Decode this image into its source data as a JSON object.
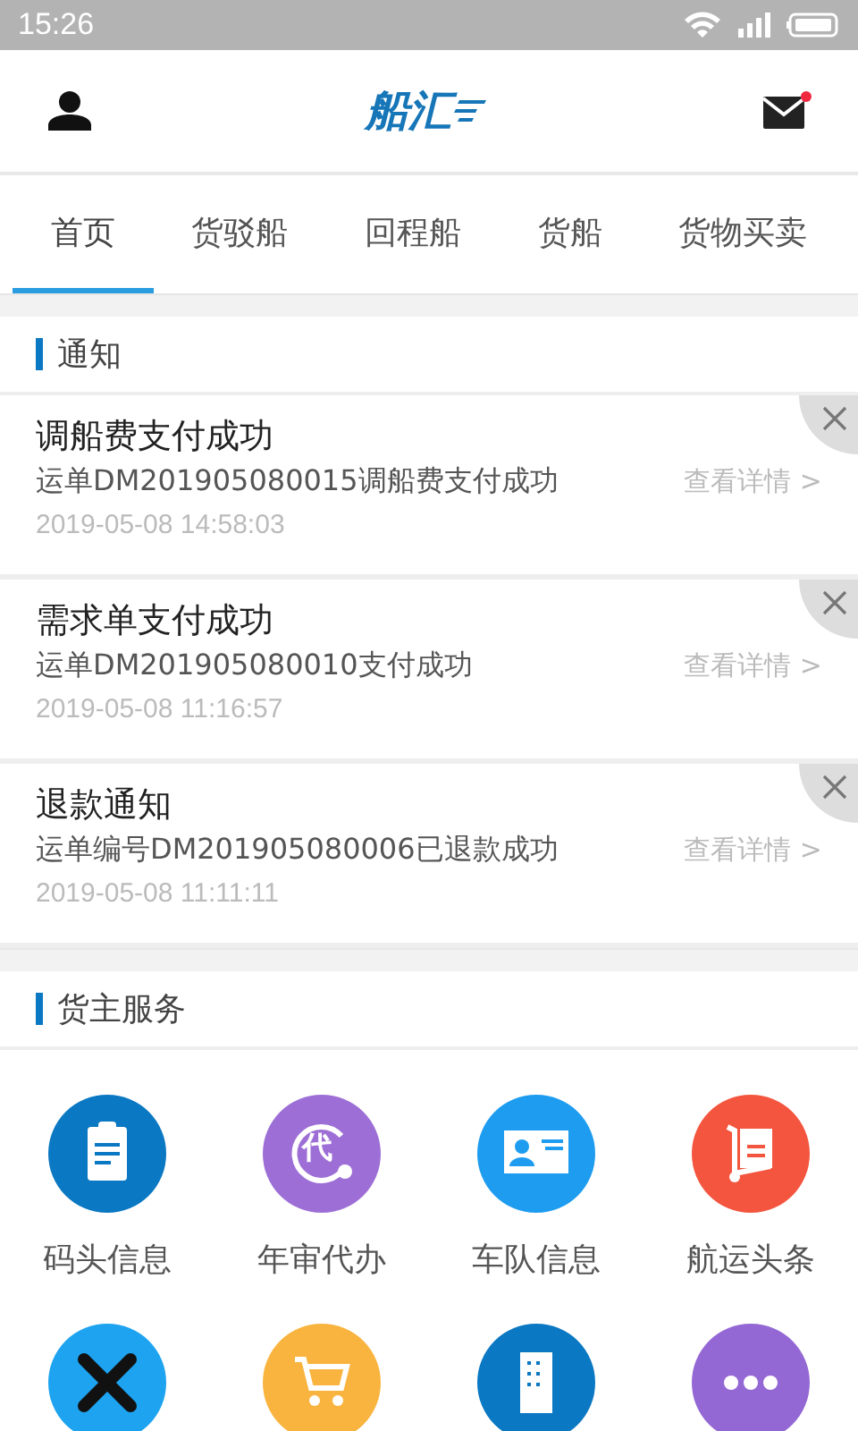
{
  "status_bar": {
    "time": "15:26"
  },
  "header": {
    "logo": "船汇",
    "mail_unread": true
  },
  "tabs": [
    {
      "label": "首页",
      "selected": true
    },
    {
      "label": "货驳船",
      "selected": false
    },
    {
      "label": "回程船",
      "selected": false
    },
    {
      "label": "货船",
      "selected": false
    },
    {
      "label": "货物买卖",
      "selected": false
    }
  ],
  "notices": {
    "title": "通知",
    "items": [
      {
        "title": "调船费支付成功",
        "body": "运单DM201905080015调船费支付成功",
        "time": "2019-05-08 14:58:03",
        "link": "查看详情 >"
      },
      {
        "title": "需求单支付成功",
        "body": "运单DM201905080010支付成功",
        "time": "2019-05-08 11:16:57",
        "link": "查看详情 >"
      },
      {
        "title": "退款通知",
        "body": "运单编号DM201905080006已退款成功",
        "time": "2019-05-08 11:11:11",
        "link": "查看详情 >"
      }
    ]
  },
  "services": {
    "title": "货主服务",
    "items": [
      {
        "kind": "clipboard",
        "label": "码头信息",
        "color": "#0a78c2"
      },
      {
        "kind": "agent",
        "label": "年审代办",
        "badge_text": "代",
        "color": "#9d6fd6"
      },
      {
        "kind": "idcard",
        "label": "车队信息",
        "color": "#1e9cf0"
      },
      {
        "kind": "cart",
        "label": "航运头条",
        "color": "#f4553e"
      },
      {
        "kind": "tools",
        "color": "#1ea3f0"
      },
      {
        "kind": "shop",
        "color": "#f9b43f"
      },
      {
        "kind": "building",
        "color": "#0a78c2"
      },
      {
        "kind": "more",
        "color": "#9468d4"
      }
    ]
  }
}
